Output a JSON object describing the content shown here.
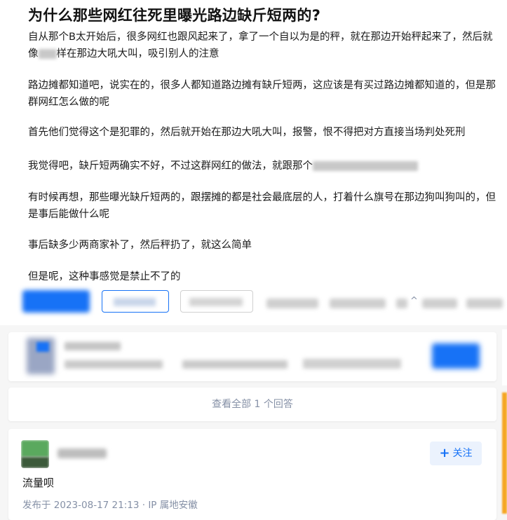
{
  "question": {
    "title": "为什么那些网红往死里曝光路边缺斤短两的?",
    "para1_part1": "自从那个B太开始后，很多网红也跟风起来了，拿了一个自以为是的秤，就在那边开始秤起来了，然后就像",
    "para1_part2": "样在那边大吼大叫，吸引别人的注意",
    "para2": "路边摊都知道吧，说实在的，很多人都知道路边摊有缺斤短两，这应该是有买过路边摊都知道的，但是那群网红怎么做的呢",
    "para3": "首先他们觉得这个是犯罪的，然后就开始在那边大吼大叫，报警，恨不得把对方直接当场判处死刑",
    "para4": "我觉得吧，缺斤短两确实不好，不过这群网红的做法，就跟那个",
    "para5": "有时候再想，那些曝光缺斤短两的，跟摆摊的都是社会最底层的人，打着什么旗号在那边狗叫狗叫的，但是事后能做什么呢",
    "para6": "事后缺多少两商家补了，然后秤扔了，就这么简单",
    "para7": "但是呢，这种事感觉是禁止不了的"
  },
  "view_all": {
    "label": "查看全部 1 个回答"
  },
  "answer": {
    "follow_label": "关注",
    "follow_icon": "plus-icon",
    "content": "流量呗",
    "meta": "发布于 2023-08-17 21:13 · IP 属地安徽"
  },
  "colors": {
    "brand": "#1772f6",
    "muted": "#8590a6",
    "follow_bg": "#ebf2fd"
  }
}
